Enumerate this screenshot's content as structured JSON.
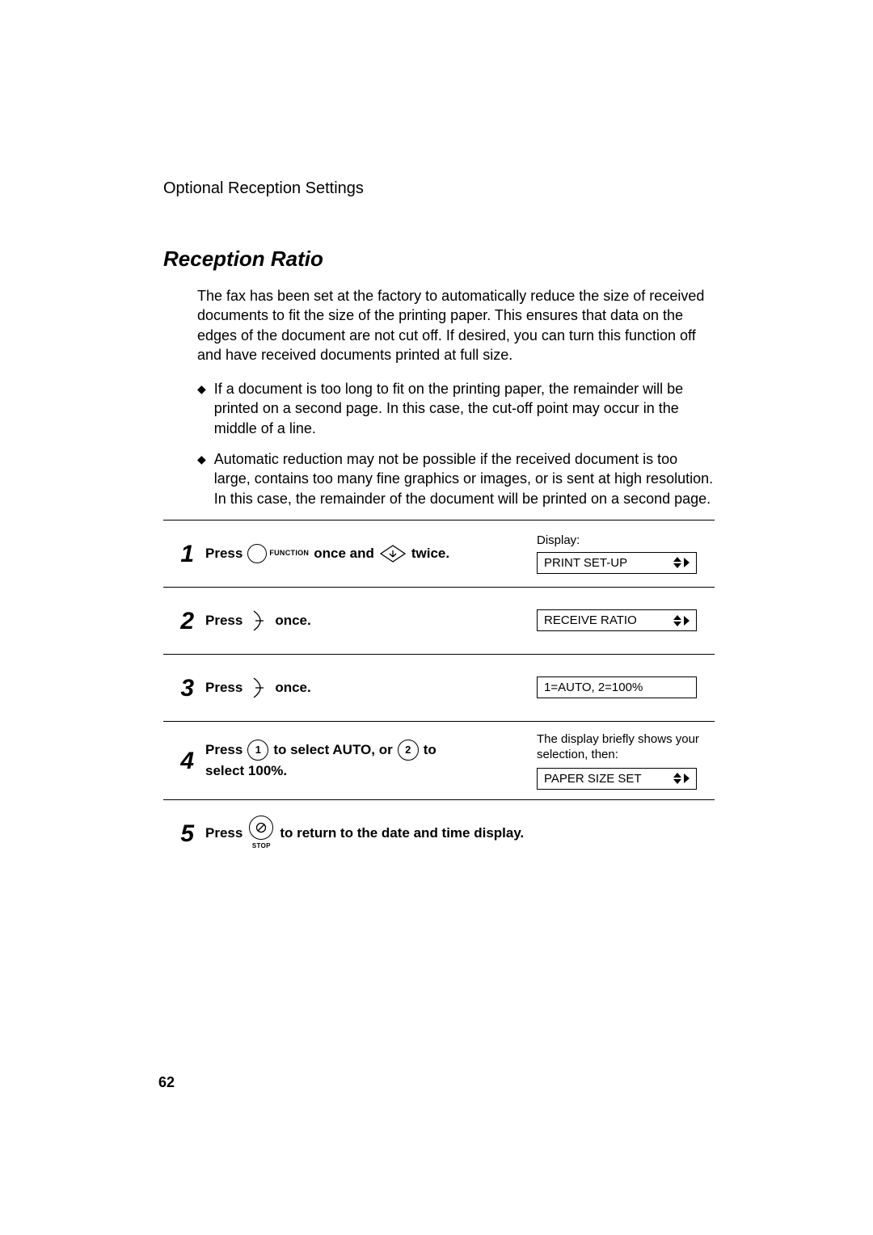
{
  "header": "Optional Reception Settings",
  "title": "Reception Ratio",
  "intro": "The fax has been set at the factory to automatically reduce the size of received documents to fit the size of the printing paper. This ensures that data on the edges of the document are not cut off. If desired, you can turn this function off and have received documents printed at full size.",
  "bullets": [
    "If a document is too long to fit on the printing paper, the remainder will be printed on a second page. In this case, the cut-off point may occur in the middle of a line.",
    "Automatic reduction may not be possible if the received document is too large, contains too many fine graphics or images, or is sent at high resolution. In this case, the remainder of the document will be printed on a second page."
  ],
  "steps": [
    {
      "num": "1",
      "text_parts": {
        "p1": "Press",
        "p2": "FUNCTION",
        "p3": "once and",
        "p4": "twice."
      },
      "display_label": "Display:",
      "lcd": "PRINT SET-UP",
      "lcd_arrows": true
    },
    {
      "num": "2",
      "text_parts": {
        "p1": "Press",
        "p2": "once."
      },
      "lcd": "RECEIVE RATIO",
      "lcd_arrows": true
    },
    {
      "num": "3",
      "text_parts": {
        "p1": "Press",
        "p2": "once."
      },
      "lcd": "1=AUTO, 2=100%",
      "lcd_arrows": false
    },
    {
      "num": "4",
      "text_parts": {
        "p1": "Press",
        "k1": "1",
        "p2": "to select AUTO, or",
        "k2": "2",
        "p3": "to",
        "p4": "select 100%."
      },
      "note": "The display briefly shows your selection, then:",
      "lcd": "PAPER SIZE SET",
      "lcd_arrows": true
    },
    {
      "num": "5",
      "text_parts": {
        "p1": "Press",
        "stop": "STOP",
        "p2": "to return to the date and time display."
      }
    }
  ],
  "page_number": "62"
}
